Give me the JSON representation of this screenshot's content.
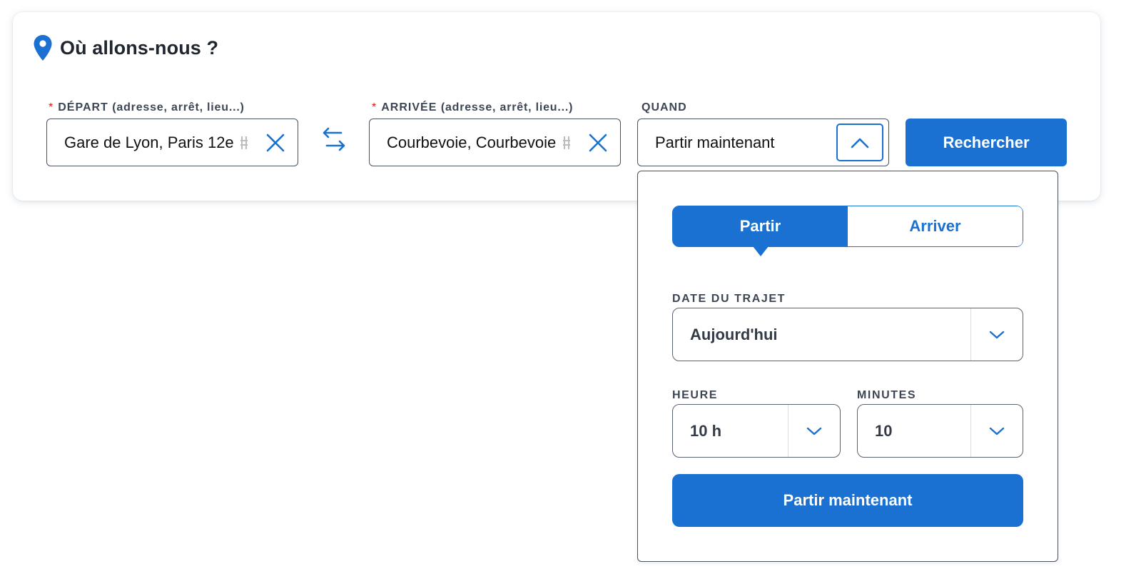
{
  "header": {
    "title": "Où allons-nous ?"
  },
  "departure": {
    "required_mark": "*",
    "label": "DÉPART",
    "hint": "(adresse, arrêt, lieu...)",
    "value": "Gare de Lyon, Paris 12e"
  },
  "arrival": {
    "required_mark": "*",
    "label": "ARRIVÉE",
    "hint": "(adresse, arrêt, lieu...)",
    "value": "Courbevoie, Courbevoie"
  },
  "when": {
    "label": "QUAND",
    "value": "Partir maintenant"
  },
  "search_button": "Rechercher",
  "dropdown": {
    "mode_options": [
      {
        "label": "Partir",
        "selected": true
      },
      {
        "label": "Arriver",
        "selected": false
      }
    ],
    "date": {
      "label": "DATE DU TRAJET",
      "value": "Aujourd'hui"
    },
    "hour": {
      "label": "HEURE",
      "value": "10 h"
    },
    "minutes": {
      "label": "MINUTES",
      "value": "10"
    },
    "now_button": "Partir maintenant"
  },
  "colors": {
    "accent": "#1a71d2",
    "required": "#d11a1a",
    "text": "#1f2630"
  },
  "icons": [
    "location-pin-icon",
    "close-icon",
    "swap-arrows-icon",
    "chevron-up-icon",
    "chevron-down-icon"
  ]
}
